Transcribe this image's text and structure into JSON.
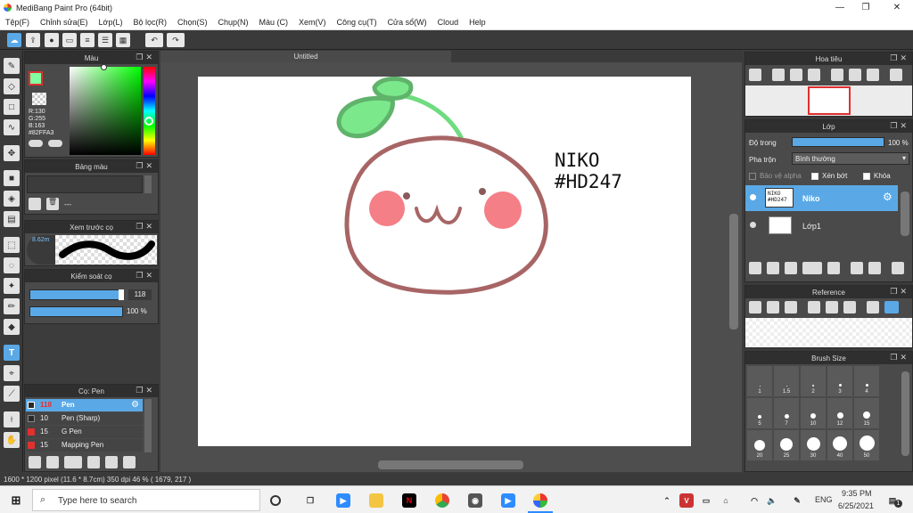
{
  "window": {
    "title": "MediBang Paint Pro (64bit)"
  },
  "menu": [
    "Tệp(F)",
    "Chỉnh sửa(E)",
    "Lớp(L)",
    "Bộ lọc(R)",
    "Chọn(S)",
    "Chụp(N)",
    "Màu (C)",
    "Xem(V)",
    "Công cụ(T)",
    "Cửa sổ(W)",
    "Cloud",
    "Help"
  ],
  "panels": {
    "color": {
      "title": "Màu",
      "r": "R:130",
      "g": "G:255",
      "b": "B:163",
      "hex": "#82FFA3",
      "fg_color": "#82FFA3"
    },
    "palette": {
      "title": "Bảng màu",
      "placeholder": "---"
    },
    "brush_preview": {
      "title": "Xem trước cọ",
      "size": "8.62m"
    },
    "brush_control": {
      "title": "Kiểm soát cọ",
      "size_value": "118",
      "opacity_value": "100 %"
    },
    "brush": {
      "title": "Cọ: Pen",
      "items": [
        {
          "size": "118",
          "name": "Pen",
          "selected": true,
          "swatch": "#2a2a2a"
        },
        {
          "size": "10",
          "name": "Pen (Sharp)",
          "selected": false,
          "swatch": "#2a2a2a"
        },
        {
          "size": "15",
          "name": "G Pen",
          "selected": false,
          "swatch": "#e03030"
        },
        {
          "size": "15",
          "name": "Mapping Pen",
          "selected": false,
          "swatch": "#e03030"
        }
      ]
    },
    "navigator": {
      "title": "Hoa tiêu"
    },
    "layer": {
      "title": "Lớp",
      "opacity_label": "Độ trong",
      "opacity_value": "100 %",
      "blend_label": "Pha trộn",
      "blend_value": "Bình thường",
      "protect_alpha": "Bảo vệ alpha",
      "clipping": "Xén bớt",
      "lock": "Khóa",
      "layers": [
        {
          "name": "Niko",
          "selected": true
        },
        {
          "name": "Lớp1",
          "selected": false
        }
      ]
    },
    "reference": {
      "title": "Reference"
    },
    "brush_size": {
      "title": "Brush Size",
      "sizes": [
        "1",
        "1.5",
        "2",
        "3",
        "4",
        "5",
        "7",
        "10",
        "12",
        "15",
        "20",
        "25",
        "30",
        "40",
        "50"
      ]
    }
  },
  "canvas": {
    "tab_title": "Untitled",
    "text_line1": "NIKO",
    "text_line2": "#HD247"
  },
  "status": {
    "text": "1600 * 1200 pixel   (11.6 * 8.7cm)   350 dpi   46 %   ( 1679, 217 )"
  },
  "taskbar": {
    "search_placeholder": "Type here to search",
    "time": "9:35 PM",
    "date": "6/25/2021",
    "lang": "ENG",
    "notification_count": "1"
  },
  "colors": {
    "leaf": "#6fdc7f",
    "outline_green": "#5fb36a",
    "face": "#a86565",
    "cheek": "#f47f86"
  }
}
